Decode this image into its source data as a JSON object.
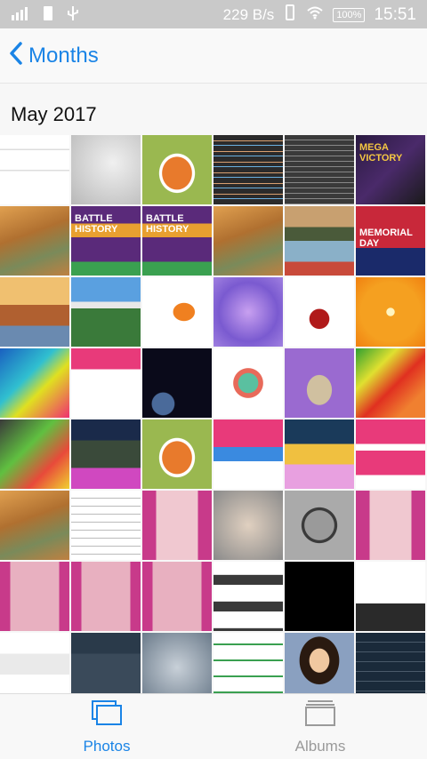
{
  "status_bar": {
    "network_speed": "229 B/s",
    "battery": "100%",
    "time": "15:51"
  },
  "nav": {
    "back_label": "Months"
  },
  "section": {
    "title": "May 2017"
  },
  "photo_captions": {
    "battle1": "BATTLE HISTORY",
    "battle2": "BATTLE HISTORY",
    "memorial": "MEMORIAL DAY",
    "victory": "MEGA VICTORY"
  },
  "tabs": [
    {
      "label": "Photos",
      "icon": "photos-icon",
      "selected": true
    },
    {
      "label": "Albums",
      "icon": "albums-icon",
      "selected": false
    }
  ],
  "colors": {
    "accent": "#1a84e6",
    "inactive": "#9a9a9a"
  }
}
